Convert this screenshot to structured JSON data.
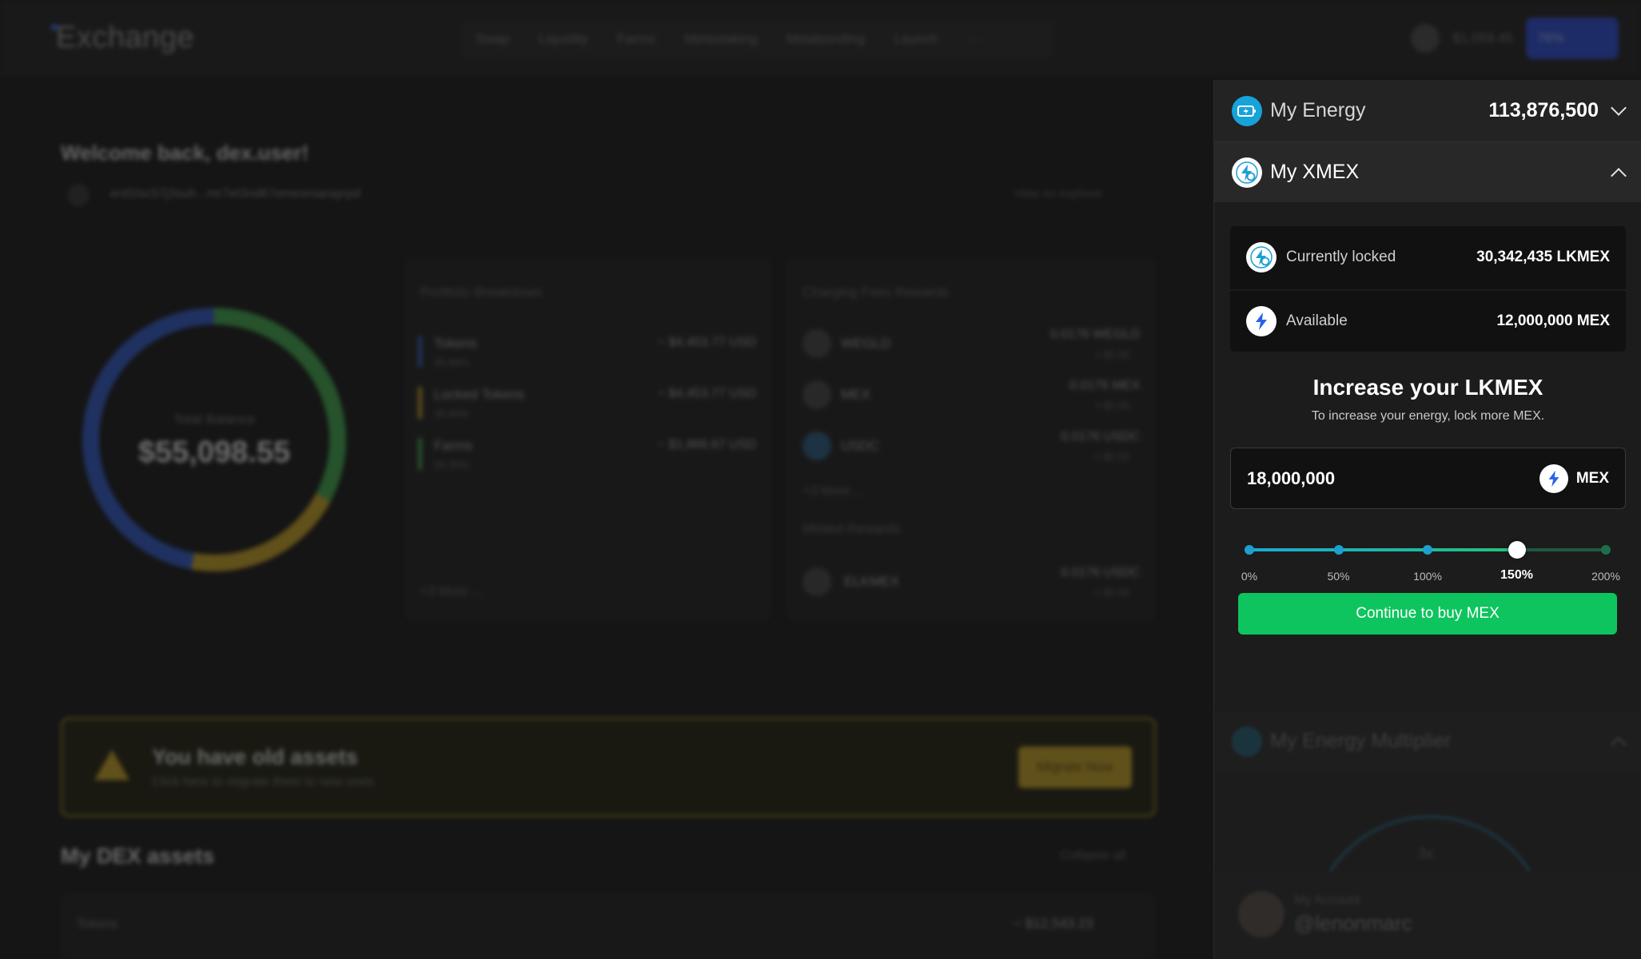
{
  "background": {
    "app_name": "Exchange",
    "nav": [
      "Swap",
      "Liquidity",
      "Farms",
      "Metastaking",
      "Metabonding",
      "Launch",
      "···"
    ],
    "wallet_balance": "$1,059.45",
    "energy_pill": "76%",
    "welcome": "Welcome back, dex.user!",
    "address": "erd1lsc57j3suh...mr7et3nd67emexmarayrpd",
    "view_explorer": "View on explorer",
    "total_balance_label": "Total Balance",
    "total_balance": "$55,098.55",
    "portfolio": {
      "title": "Portfolio Breakdown",
      "rows": [
        {
          "name": "Tokens",
          "pct": "35.84%",
          "value": "~ $4,453.77 USD",
          "color": "#2f59c9"
        },
        {
          "name": "Locked Tokens",
          "pct": "35.84%",
          "value": "~ $4,453.77 USD",
          "color": "#c9a223"
        },
        {
          "name": "Farms",
          "pct": "28.30%",
          "value": "~ $1,866.67 USD",
          "color": "#3ea84b"
        }
      ],
      "more": "+3 More ..."
    },
    "fees": {
      "title": "Charging Fees Rewards",
      "rows": [
        {
          "name": "WEGLD",
          "value": "0.0176 WEGLD",
          "sub": "≈ $5.55"
        },
        {
          "name": "MEX",
          "value": "0.0176 MEX",
          "sub": "≈ $5.55"
        },
        {
          "name": "USDC",
          "value": "0.0176 USDC",
          "sub": "≈ $5.55"
        }
      ],
      "more": "+3 More ...",
      "minted_title": "Minted Rewards",
      "minted": {
        "name": "ELKMEX",
        "value": "0.0176 USDC",
        "sub": "≈ $5.55"
      }
    },
    "warning": {
      "title": "You have old assets",
      "subtitle": "Click here to migrate them to new ones.",
      "button": "Migrate Now"
    },
    "dex_title": "My DEX assets",
    "collapse_all": "Collapse all",
    "tokens_label": "Tokens",
    "tokens_value": "~ $12,543.23"
  },
  "drawer": {
    "energy": {
      "title": "My Energy",
      "value": "113,876,500"
    },
    "xmex": {
      "title": "My XMEX",
      "locked_label": "Currently locked",
      "locked_value": "30,342,435 LKMEX",
      "available_label": "Available",
      "available_value": "12,000,000 MEX",
      "increase_title": "Increase your LKMEX",
      "increase_subtitle": "To increase your energy, lock more MEX.",
      "amount": "18,000,000",
      "token": "MEX",
      "slider_ticks": [
        "0%",
        "50%",
        "100%",
        "150%",
        "200%"
      ],
      "slider_value": "150%",
      "slider_fraction": 0.75,
      "cta": "Continue to buy MEX"
    },
    "multiplier": {
      "title": "My Energy Multiplier",
      "value": "3x"
    },
    "account": {
      "label": "My Account",
      "handle": "@lenonmarc"
    }
  },
  "colors": {
    "accent_blue": "#1d9fd0",
    "cta_green": "#0ec45f",
    "energy_icon": "#16a3d9"
  }
}
